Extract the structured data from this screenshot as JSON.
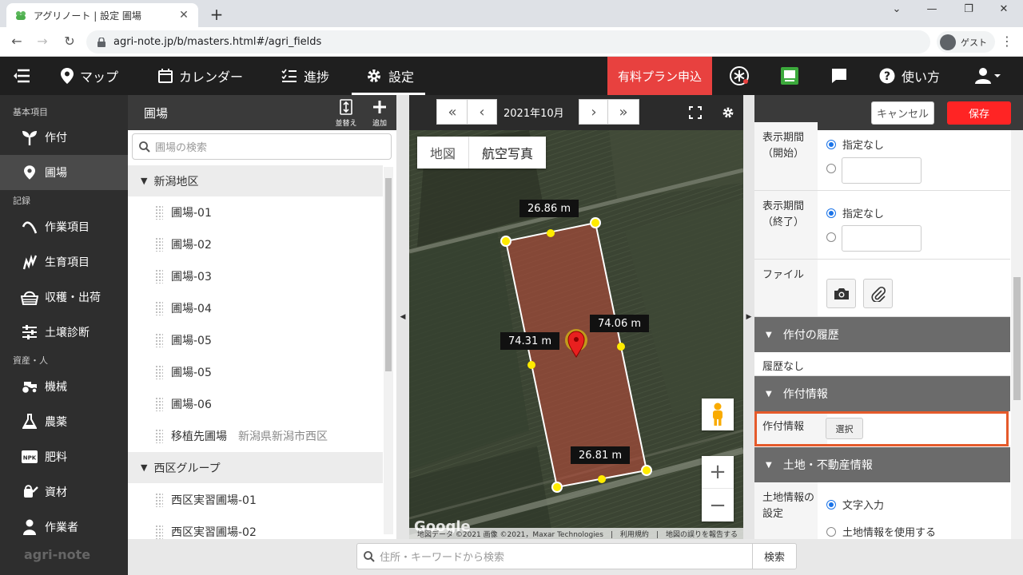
{
  "browser": {
    "tab_title": "アグリノート | 設定 圃場",
    "url": "agri-note.jp/b/masters.html#/agri_fields",
    "profile": "ゲスト"
  },
  "appbar": {
    "items": [
      "マップ",
      "カレンダー",
      "進捗",
      "設定"
    ],
    "paid_plan": "有料プラン申込",
    "help": "使い方"
  },
  "sidebar": {
    "sections": [
      "基本項目",
      "記録",
      "資産・人"
    ],
    "items": [
      "作付",
      "圃場",
      "作業項目",
      "生育項目",
      "収穫・出荷",
      "土壌診断",
      "機械",
      "農薬",
      "肥料",
      "資材",
      "作業者"
    ],
    "logo": "agri-note"
  },
  "fields_panel": {
    "title": "圃場",
    "sort_label": "並替え",
    "add_label": "追加",
    "search_placeholder": "圃場の検索",
    "groups": [
      {
        "name": "新潟地区",
        "items": [
          {
            "name": "圃場-01",
            "sub": ""
          },
          {
            "name": "圃場-02",
            "sub": ""
          },
          {
            "name": "圃場-03",
            "sub": ""
          },
          {
            "name": "圃場-04",
            "sub": ""
          },
          {
            "name": "圃場-05",
            "sub": ""
          },
          {
            "name": "圃場-05",
            "sub": ""
          },
          {
            "name": "圃場-06",
            "sub": ""
          },
          {
            "name": "移植先圃場",
            "sub": "新潟県新潟市西区"
          }
        ]
      },
      {
        "name": "西区グループ",
        "items": [
          {
            "name": "西区実習圃場-01",
            "sub": ""
          },
          {
            "name": "西区実習圃場-02",
            "sub": ""
          }
        ]
      }
    ]
  },
  "map": {
    "month": "2021年10月",
    "type_map": "地図",
    "type_aerial": "航空写真",
    "dimensions": [
      "26.86 m",
      "74.06 m",
      "74.31 m",
      "26.81 m"
    ],
    "attribution": "地図データ ©2021 画像 ©2021，Maxar Technologies　|　利用規約　|　地図の誤りを報告する",
    "google": "Google"
  },
  "right_panel": {
    "cancel": "キャンセル",
    "save": "保存",
    "start_label": "表示期間（開始）",
    "end_label": "表示期間（終了）",
    "none_option": "指定なし",
    "file_label": "ファイル",
    "history_section": "作付の履歴",
    "history_none": "履歴なし",
    "crop_section": "作付情報",
    "crop_label": "作付情報",
    "select_button": "選択",
    "land_section": "土地・不動産情報",
    "land_label": "土地情報の設定",
    "land_opt1": "文字入力",
    "land_opt2": "土地情報を使用する"
  },
  "bottom": {
    "address_placeholder": "住所・キーワードから検索",
    "search_button": "検索"
  },
  "colors": {
    "accent_red": "#e8413f",
    "save_red": "#ff2424",
    "highlight": "#e55a2b"
  }
}
